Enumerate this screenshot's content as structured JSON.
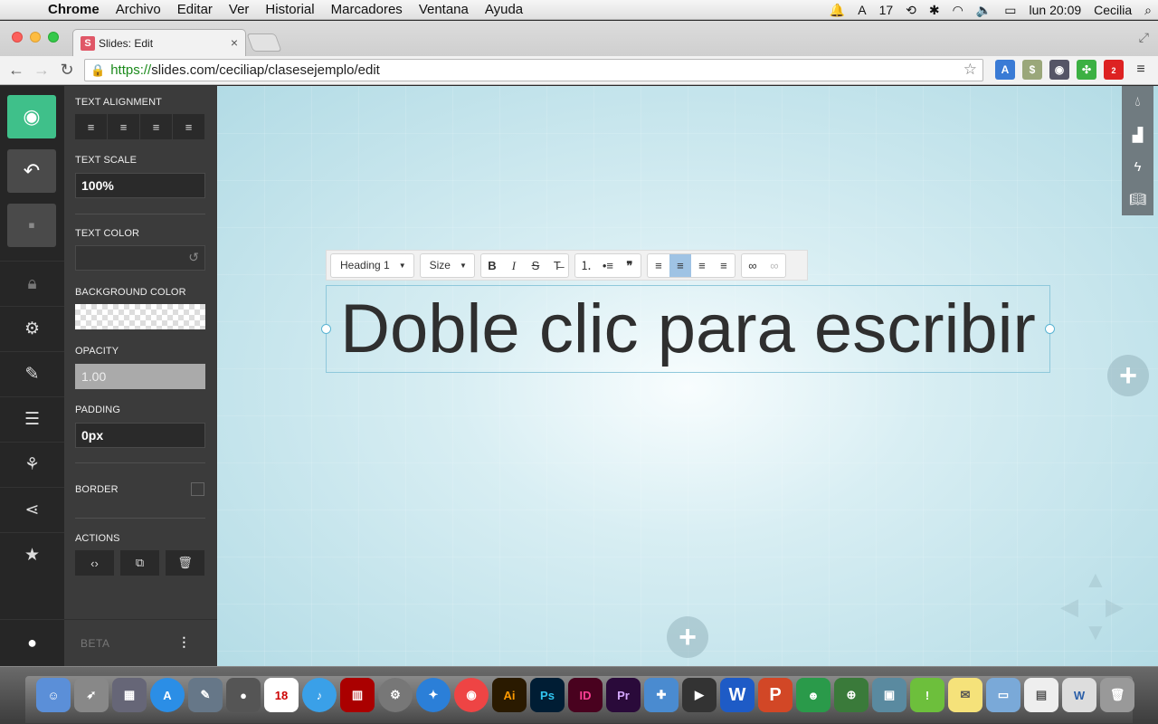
{
  "menubar": {
    "app": "Chrome",
    "items": [
      "Archivo",
      "Editar",
      "Ver",
      "Historial",
      "Marcadores",
      "Ventana",
      "Ayuda"
    ],
    "status_count": "17",
    "clock": "lun 20:09",
    "user": "Cecilia"
  },
  "browser": {
    "tab_title": "Slides: Edit",
    "favicon_letter": "S",
    "url_https": "https://",
    "url_rest": "slides.com/ceciliap/clasesejemplo/edit",
    "extension_badge": "2"
  },
  "panel": {
    "text_alignment": "TEXT ALIGNMENT",
    "text_scale": "TEXT SCALE",
    "text_scale_value": "100%",
    "text_color": "TEXT COLOR",
    "background_color": "BACKGROUND COLOR",
    "opacity": "OPACITY",
    "opacity_value": "1.00",
    "padding": "PADDING",
    "padding_value": "0px",
    "border": "BORDER",
    "actions": "ACTIONS",
    "beta": "BETA"
  },
  "editor": {
    "heading_dropdown": "Heading 1",
    "size_dropdown": "Size",
    "slide_text": "Doble clic para escribir"
  },
  "colors": {
    "accent": "#3fc08a",
    "canvas": "#b2dbe5"
  }
}
